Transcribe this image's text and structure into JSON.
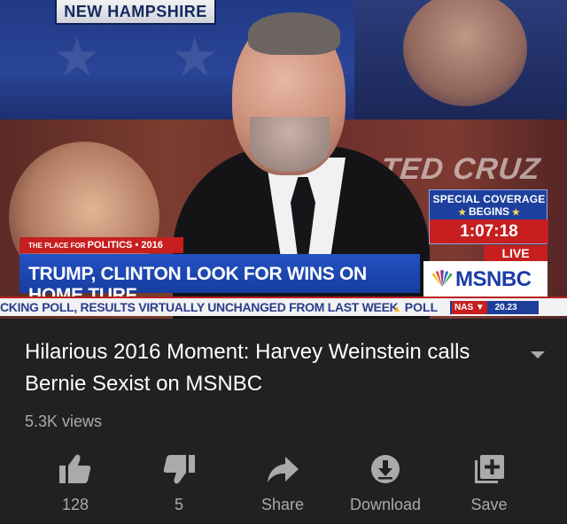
{
  "video": {
    "state_banner": "NEW HAMPSHIRE",
    "background_name": "TED CRUZ",
    "coverage": {
      "title": "SPECIAL COVERAGE",
      "subtitle": "BEGINS",
      "countdown": "1:07:18"
    },
    "live_label": "LIVE",
    "network": "MSNBC",
    "place_tag_a": "THE PLACE ",
    "place_tag_b": "FOR ",
    "place_tag_c": "POLITICS",
    "place_tag_d": " • 2016",
    "headline": "TRUMP, CLINTON LOOK FOR WINS ON HOME TURF",
    "ticker": "CKING POLL, RESULTS VIRTUALLY UNCHANGED FROM LAST WEEK",
    "ticker_poll": "POLL",
    "nas_label": "NAS ▼",
    "nas_value": "20.23"
  },
  "info": {
    "title": "Hilarious 2016 Moment: Harvey Weinstein calls Bernie Sexist on MSNBC",
    "views": "5.3K views"
  },
  "actions": {
    "like_count": "128",
    "dislike_count": "5",
    "share_label": "Share",
    "download_label": "Download",
    "save_label": "Save"
  },
  "colors": {
    "background": "#212121",
    "secondary_text": "#aaaaaa",
    "msnbc_blue": "#1a3da8",
    "alert_red": "#c71f1f"
  }
}
